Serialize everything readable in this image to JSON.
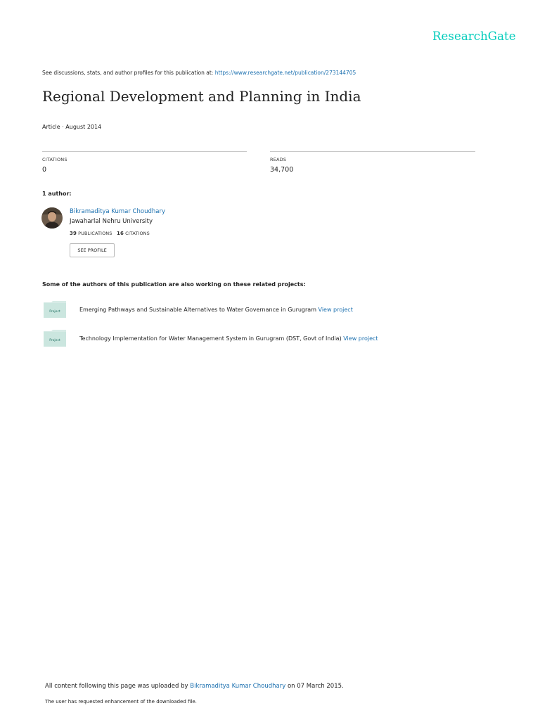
{
  "brand": {
    "name": "ResearchGate"
  },
  "header": {
    "see_text": "See discussions, stats, and author profiles for this publication at:",
    "url": "https://www.researchgate.net/publication/273144705"
  },
  "publication": {
    "title": "Regional Development and Planning in India",
    "type_date": "Article · August 2014"
  },
  "stats": {
    "citations_label": "CITATIONS",
    "citations_value": "0",
    "reads_label": "READS",
    "reads_value": "34,700"
  },
  "authors": {
    "heading": "1 author:",
    "items": [
      {
        "name": "Bikramaditya Kumar Choudhary",
        "institution": "Jawaharlal Nehru University",
        "publications_count": "39",
        "publications_label": "PUBLICATIONS",
        "citations_count": "16",
        "citations_label": "CITATIONS",
        "button_label": "SEE PROFILE"
      }
    ]
  },
  "related": {
    "heading": "Some of the authors of this publication are also working on these related projects:",
    "projects": [
      {
        "icon_label": "Project",
        "text": "Emerging Pathways and Sustainable Alternatives to Water Governance in Gurugram",
        "link": "View project"
      },
      {
        "icon_label": "Project",
        "text": "Technology Implementation for Water Management System in Gurugram (DST, Govt of India)",
        "link": "View project"
      }
    ]
  },
  "footer": {
    "uploaded_prefix": "All content following this page was uploaded by",
    "uploader": "Bikramaditya Kumar Choudhary",
    "uploaded_suffix": "on 07 March 2015.",
    "note": "The user has requested enhancement of the downloaded file."
  },
  "colors": {
    "brand": "#00ccbb",
    "link": "#1a6faf",
    "rule": "#c8c8c8"
  }
}
